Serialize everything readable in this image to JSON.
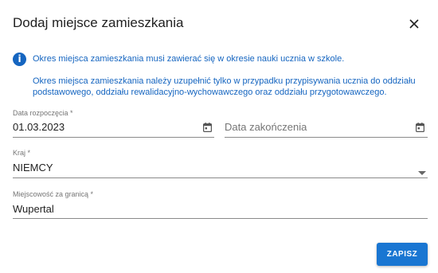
{
  "dialog": {
    "title": "Dodaj miejsce zamieszkania",
    "close_icon": "close-icon"
  },
  "info": {
    "icon": "info-icon",
    "icon_glyph": "i",
    "line1": "Okres miejsca zamieszkania musi zawierać się w okresie nauki ucznia w szkole.",
    "line2": "Okres miejsca zamieszkania należy uzupełnić tylko w przypadku przypisywania ucznia do oddziału podstawowego, oddziału rewalidacyjno-wychowawczego oraz oddziału przygotowawczego.",
    "color": "#1565c0"
  },
  "form": {
    "start_date": {
      "label": "Data rozpoczęcia *",
      "value": "01.03.2023",
      "icon": "calendar-icon"
    },
    "end_date": {
      "placeholder": "Data zakończenia",
      "value": "",
      "icon": "calendar-icon"
    },
    "country": {
      "label": "Kraj *",
      "value": "NIEMCY",
      "icon": "dropdown-arrow-icon"
    },
    "city": {
      "label": "Miejscowość za granicą *",
      "value": "Wupertal"
    }
  },
  "actions": {
    "save_label": "ZAPISZ",
    "accent": "#1976d2"
  }
}
